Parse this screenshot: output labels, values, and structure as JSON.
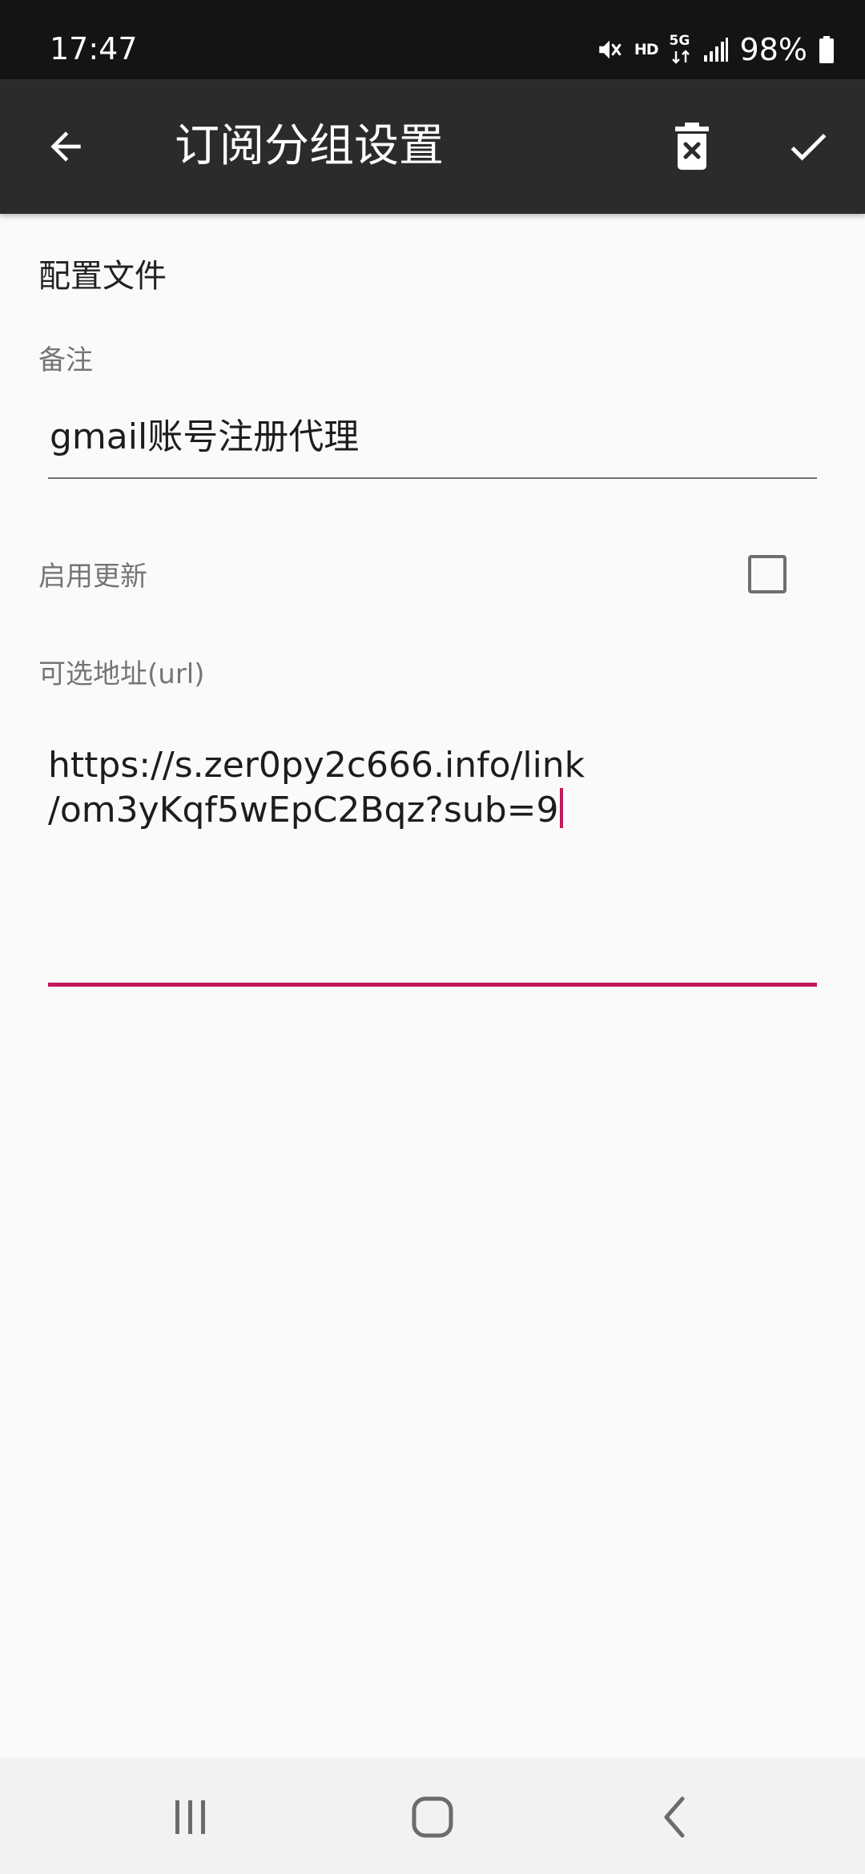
{
  "status_bar": {
    "time": "17:47",
    "hd_label": "HD",
    "network_label": "5G",
    "battery_percent": "98%",
    "icons": [
      "mute-icon",
      "hd-icon",
      "5g-data-icon",
      "signal-icon",
      "battery-icon"
    ]
  },
  "app_bar": {
    "title": "订阅分组设置",
    "icons": [
      "back-arrow-icon",
      "delete-icon",
      "check-icon"
    ]
  },
  "form": {
    "section_title": "配置文件",
    "remark": {
      "label": "备注",
      "value": "gmail账号注册代理"
    },
    "enable_update": {
      "label": "启用更新",
      "checked": false
    },
    "url": {
      "label": "可选地址(url)",
      "value_line1": "https://s.zer0py2c666.info/link",
      "value_line2": "/om3yKqf5wEpC2Bqz?sub=9",
      "focused": true
    }
  },
  "colors": {
    "status_bar_bg": "#141414",
    "app_bar_bg": "#2b2b2b",
    "page_bg": "#fafafa",
    "accent": "#c2185b",
    "label_gray": "#757575"
  },
  "nav_bar": {
    "icons": [
      "recents-icon",
      "home-icon",
      "back-icon"
    ]
  }
}
